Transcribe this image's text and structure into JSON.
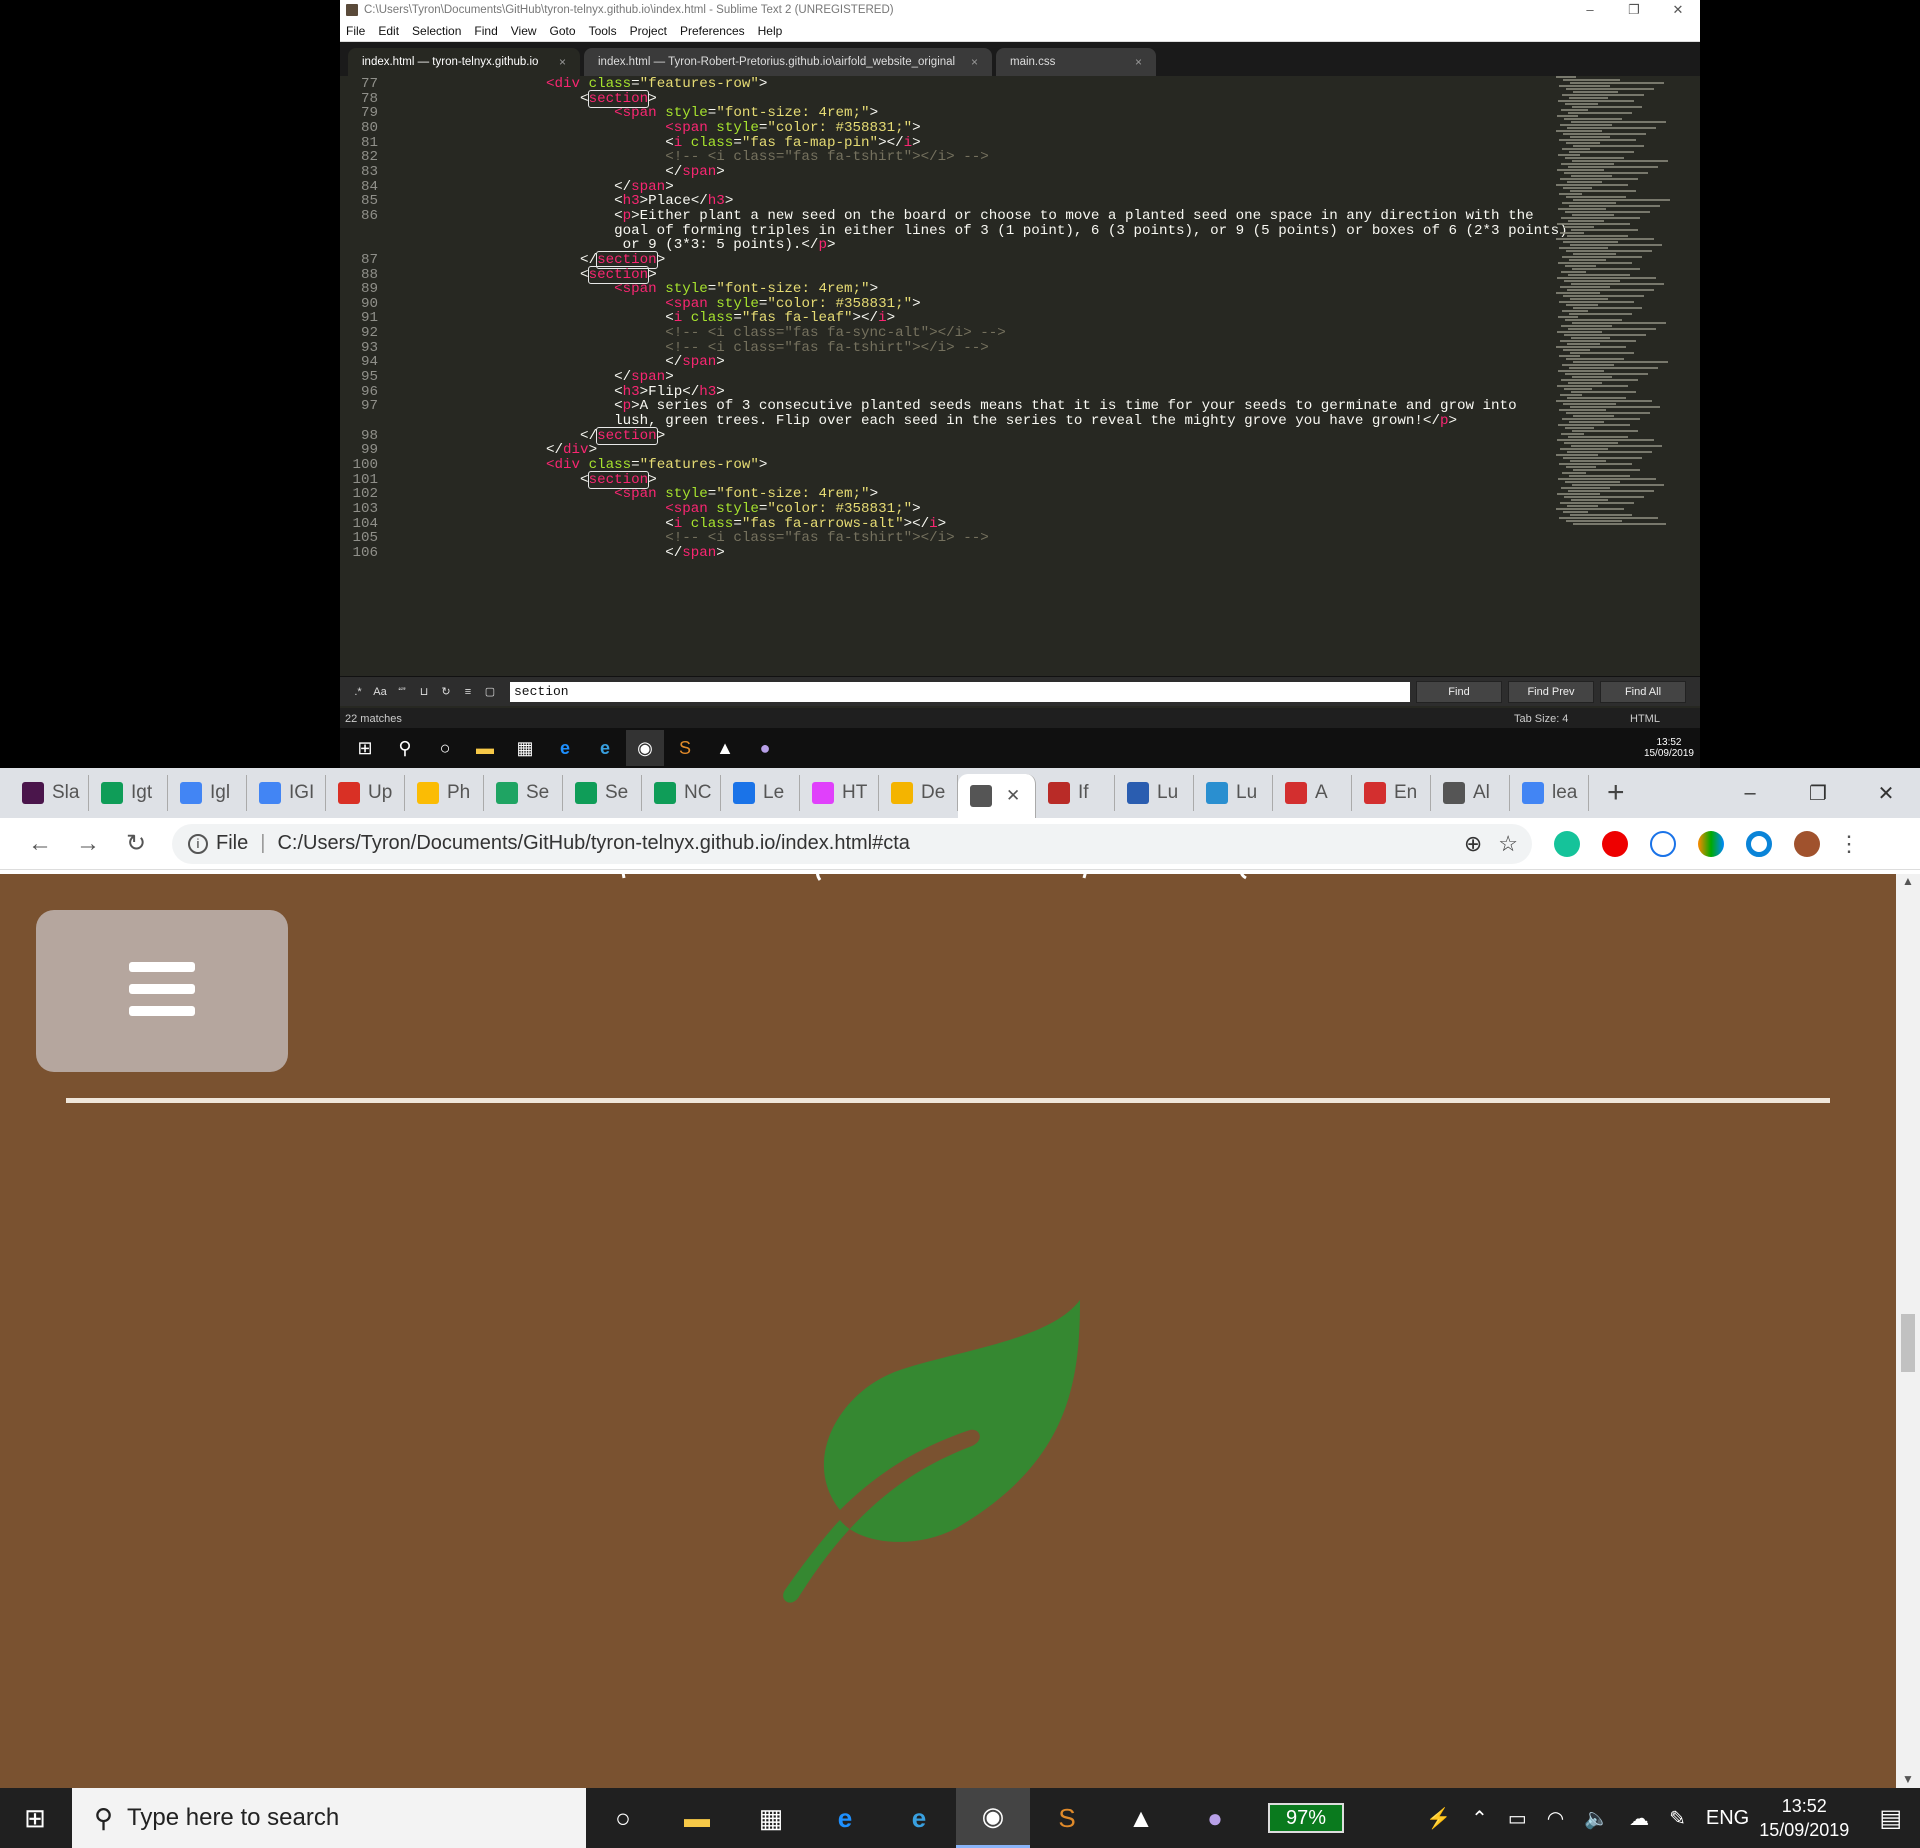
{
  "sublime": {
    "title": "C:\\Users\\Tyron\\Documents\\GitHub\\tyron-telnyx.github.io\\index.html - Sublime Text 2 (UNREGISTERED)",
    "menu": [
      "File",
      "Edit",
      "Selection",
      "Find",
      "View",
      "Goto",
      "Tools",
      "Project",
      "Preferences",
      "Help"
    ],
    "tabs": [
      {
        "label": "index.html — tyron-telnyx.github.io",
        "close": "×"
      },
      {
        "label": "index.html — Tyron-Robert-Pretorius.github.io\\airfold_website_original",
        "close": "×"
      },
      {
        "label": "main.css",
        "close": "×"
      }
    ],
    "lines": [
      {
        "n": "77",
        "html": "<span class='tag'>&lt;div</span> <span class='attr'>class</span>=<span class='str'>\"features-row\"</span>&gt;"
      },
      {
        "n": "78",
        "html": "    &lt;<span class='tag hl'>section</span>&gt;"
      },
      {
        "n": "79",
        "html": "        <span class='tag'>&lt;span</span> <span class='attr'>style</span>=<span class='str'>\"font-size: 4rem;\"</span>&gt;"
      },
      {
        "n": "80",
        "html": "              <span class='tag'>&lt;span</span> <span class='attr'>style</span>=<span class='str'>\"color: #358831;\"</span>&gt;"
      },
      {
        "n": "81",
        "html": "              &lt;<span class='tag'>i</span> <span class='attr'>class</span>=<span class='str'>\"fas fa-map-pin\"</span>&gt;&lt;/<span class='tag'>i</span>&gt;"
      },
      {
        "n": "82",
        "html": "              <span class='cmt'>&lt;!-- &lt;i class=\"fas fa-tshirt\"&gt;&lt;/i&gt; --&gt;</span>"
      },
      {
        "n": "83",
        "html": "              &lt;/<span class='tag'>span</span>&gt;"
      },
      {
        "n": "84",
        "html": "        &lt;/<span class='tag'>span</span>&gt;"
      },
      {
        "n": "85",
        "html": "        &lt;<span class='tag'>h3</span>&gt;Place&lt;/<span class='tag'>h3</span>&gt;"
      },
      {
        "n": "86",
        "html": "        &lt;<span class='tag'>p</span>&gt;Either plant a new seed on the board or choose to move a planted seed one space in any direction with the"
      },
      {
        "n": "",
        "html": "        goal of forming triples in either lines of 3 (1 point), 6 (3 points), or 9 (5 points) or boxes of 6 (2*3 points)"
      },
      {
        "n": "",
        "html": "         or 9 (3*3: 5 points).&lt;/<span class='tag'>p</span>&gt;"
      },
      {
        "n": "87",
        "html": "    &lt;/<span class='tag hl'>section</span>&gt;"
      },
      {
        "n": "88",
        "html": "    &lt;<span class='tag hl'>section</span>&gt;"
      },
      {
        "n": "89",
        "html": "        <span class='tag'>&lt;span</span> <span class='attr'>style</span>=<span class='str'>\"font-size: 4rem;\"</span>&gt;"
      },
      {
        "n": "90",
        "html": "              <span class='tag'>&lt;span</span> <span class='attr'>style</span>=<span class='str'>\"color: #358831;\"</span>&gt;"
      },
      {
        "n": "91",
        "html": "              &lt;<span class='tag'>i</span> <span class='attr'>class</span>=<span class='str'>\"fas fa-leaf\"</span>&gt;&lt;/<span class='tag'>i</span>&gt;"
      },
      {
        "n": "92",
        "html": "              <span class='cmt'>&lt;!-- &lt;i class=\"fas fa-sync-alt\"&gt;&lt;/i&gt; --&gt;</span>"
      },
      {
        "n": "93",
        "html": "              <span class='cmt'>&lt;!-- &lt;i class=\"fas fa-tshirt\"&gt;&lt;/i&gt; --&gt;</span>"
      },
      {
        "n": "94",
        "html": "              &lt;/<span class='tag'>span</span>&gt;"
      },
      {
        "n": "95",
        "html": "        &lt;/<span class='tag'>span</span>&gt;"
      },
      {
        "n": "96",
        "html": "        &lt;<span class='tag'>h3</span>&gt;Flip&lt;/<span class='tag'>h3</span>&gt;"
      },
      {
        "n": "97",
        "html": "        &lt;<span class='tag'>p</span>&gt;A series of 3 consecutive planted seeds means that it is time for your seeds to germinate and grow into"
      },
      {
        "n": "",
        "html": "        lush, green trees. Flip over each seed in the series to reveal the mighty grove you have grown!&lt;/<span class='tag'>p</span>&gt;"
      },
      {
        "n": "98",
        "html": "    &lt;/<span class='tag hl'>section</span>&gt;"
      },
      {
        "n": "99",
        "html": "&lt;/<span class='tag'>div</span>&gt;"
      },
      {
        "n": "100",
        "html": "<span class='tag'>&lt;div</span> <span class='attr'>class</span>=<span class='str'>\"features-row\"</span>&gt;"
      },
      {
        "n": "101",
        "html": "    &lt;<span class='tag hl'>section</span>&gt;"
      },
      {
        "n": "102",
        "html": "        <span class='tag'>&lt;span</span> <span class='attr'>style</span>=<span class='str'>\"font-size: 4rem;\"</span>&gt;"
      },
      {
        "n": "103",
        "html": "              <span class='tag'>&lt;span</span> <span class='attr'>style</span>=<span class='str'>\"color: #358831;\"</span>&gt;"
      },
      {
        "n": "104",
        "html": "              &lt;<span class='tag'>i</span> <span class='attr'>class</span>=<span class='str'>\"fas fa-arrows-alt\"</span>&gt;&lt;/<span class='tag'>i</span>&gt;"
      },
      {
        "n": "105",
        "html": "              <span class='cmt'>&lt;!-- &lt;i class=\"fas fa-tshirt\"&gt;&lt;/i&gt; --&gt;</span>"
      },
      {
        "n": "106",
        "html": "              &lt;/<span class='tag'>span</span>&gt;"
      }
    ],
    "find": {
      "value": "section",
      "find": "Find",
      "find_prev": "Find Prev",
      "find_all": "Find All"
    },
    "status": {
      "matches": "22 matches",
      "tab_size": "Tab Size: 4",
      "syntax": "HTML"
    },
    "taskbar_time": "13:52",
    "taskbar_date": "15/09/2019"
  },
  "chrome": {
    "tabs": [
      {
        "label": "Sla",
        "icon": "slack-icon",
        "color": "#4a154b"
      },
      {
        "label": "Igt",
        "icon": "sheets-icon",
        "color": "#0f9d58"
      },
      {
        "label": "Igl",
        "icon": "docs-icon",
        "color": "#4285f4"
      },
      {
        "label": "IGI",
        "icon": "docs-icon",
        "color": "#4285f4"
      },
      {
        "label": "Up",
        "icon": "gmail-icon",
        "color": "#d93025"
      },
      {
        "label": "Ph",
        "icon": "photos-icon",
        "color": "#fbbc04"
      },
      {
        "label": "Se",
        "icon": "drive-icon",
        "color": "#1fa463"
      },
      {
        "label": "Se",
        "icon": "sheets-icon",
        "color": "#0f9d58"
      },
      {
        "label": "NC",
        "icon": "sheets-icon",
        "color": "#0f9d58"
      },
      {
        "label": "Le",
        "icon": "flag-icon",
        "color": "#1a73e8"
      },
      {
        "label": "HT",
        "icon": "color-wheel-icon",
        "color": "#e040fb"
      },
      {
        "label": "De",
        "icon": "slides-icon",
        "color": "#f4b400"
      },
      {
        "label": "",
        "icon": "globe-icon",
        "color": "#555555",
        "active": true
      },
      {
        "label": "If",
        "icon": "quora-icon",
        "color": "#b92b27"
      },
      {
        "label": "Lu",
        "icon": "stack-icon",
        "color": "#2a5db0"
      },
      {
        "label": "Lu",
        "icon": "stack-icon",
        "color": "#2a8fd0"
      },
      {
        "label": "A",
        "icon": "bars-icon",
        "color": "#d32f2f"
      },
      {
        "label": "En",
        "icon": "bars-icon",
        "color": "#d32f2f"
      },
      {
        "label": "Al",
        "icon": "globe-icon",
        "color": "#555555"
      },
      {
        "label": "lea",
        "icon": "google-icon",
        "color": "#4285f4"
      }
    ],
    "address": {
      "scheme": "File",
      "url": "C:/Users/Tyron/Documents/GitHub/tyron-telnyx.github.io/index.html#cta"
    }
  },
  "page": {
    "bg": "#7a5230",
    "menu_btn": "#b5a69e",
    "leaf_color": "#358831"
  },
  "taskbar": {
    "search_placeholder": "Type here to search",
    "battery": "97%",
    "lang": "ENG",
    "time": "13:52",
    "date": "15/09/2019"
  }
}
